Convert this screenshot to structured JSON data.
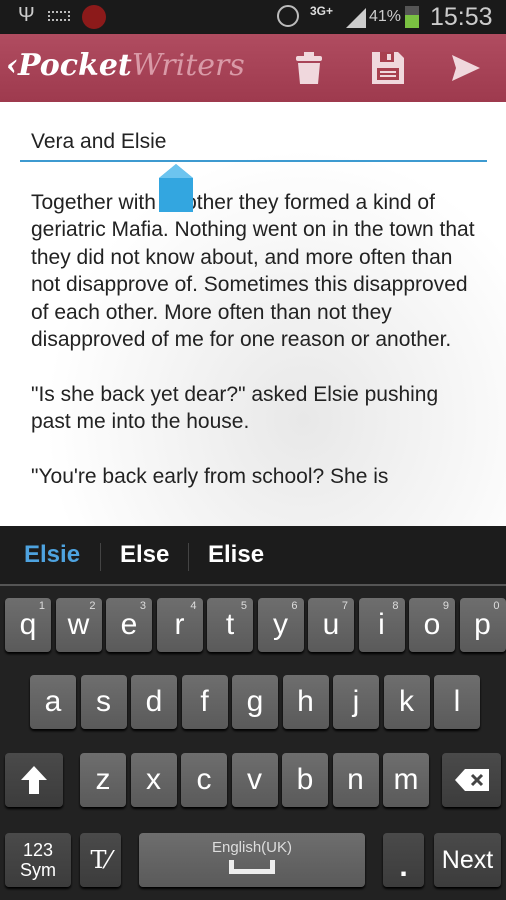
{
  "status_bar": {
    "network": "3G+",
    "battery": "41%",
    "time": "15:53",
    "icons": [
      "usb-icon",
      "keyboard-icon",
      "lock-icon",
      "alarm-icon",
      "signal-icon",
      "battery-charging-icon"
    ]
  },
  "app_bar": {
    "title_part1": "Pocket",
    "title_part2": "Writers",
    "actions": [
      "trash-icon",
      "save-icon",
      "send-icon"
    ],
    "accent": "#a03c50"
  },
  "editor": {
    "title": "Vera and Elsie",
    "body": "Together with another they formed a kind of geriatric Mafia. Nothing went on in the town that they did not know about, and more often than not disapprove of. Sometimes this disapproved of each other. More often than not they disapproved of me for one reason or another.\n\n\"Is she back yet dear?\" asked Elsie pushing past me into the house.\n\n\"You're back early from school? She is"
  },
  "keyboard": {
    "suggestions": [
      "Elsie",
      "Else",
      "Elise"
    ],
    "row1": [
      [
        "q",
        "1"
      ],
      [
        "w",
        "2"
      ],
      [
        "e",
        "3"
      ],
      [
        "r",
        "4"
      ],
      [
        "t",
        "5"
      ],
      [
        "y",
        "6"
      ],
      [
        "u",
        "7"
      ],
      [
        "i",
        "8"
      ],
      [
        "o",
        "9"
      ],
      [
        "p",
        "0"
      ]
    ],
    "row2": [
      "a",
      "s",
      "d",
      "f",
      "g",
      "h",
      "j",
      "k",
      "l"
    ],
    "row3": [
      "z",
      "x",
      "c",
      "v",
      "b",
      "n",
      "m"
    ],
    "sym_top": "123",
    "sym_bottom": "Sym",
    "space_label": "English(UK)",
    "period": ".",
    "next": "Next"
  }
}
